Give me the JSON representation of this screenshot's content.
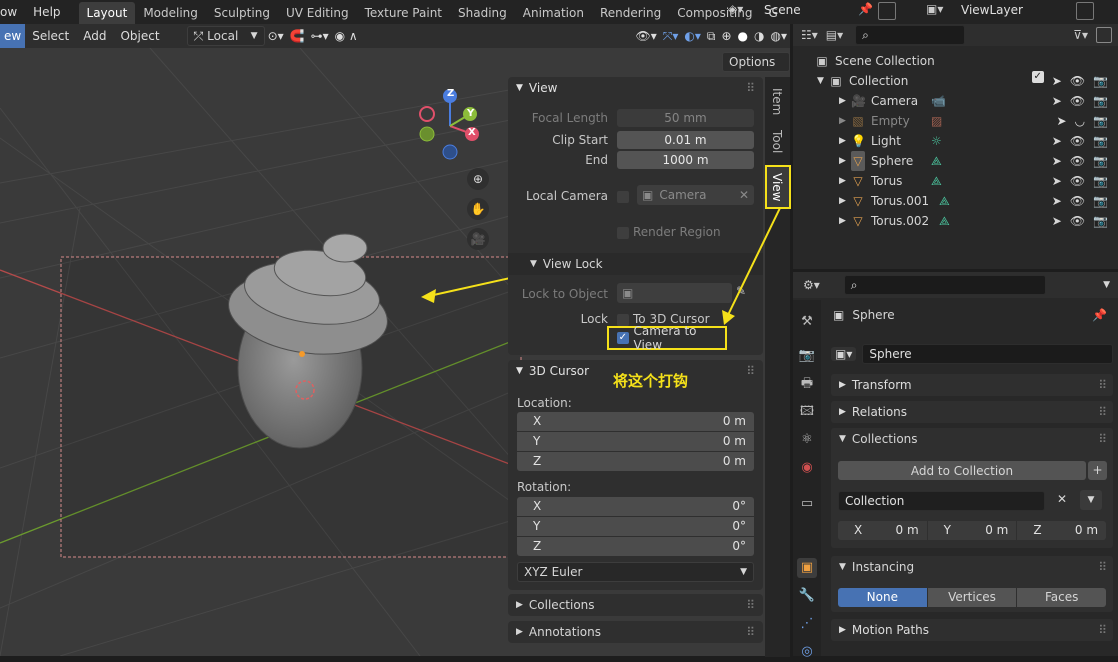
{
  "topbar": {
    "menus": [
      "ow",
      "Help"
    ],
    "workspaces": [
      "Layout",
      "Modeling",
      "Sculpting",
      "UV Editing",
      "Texture Paint",
      "Shading",
      "Animation",
      "Rendering",
      "Compositing",
      "G"
    ],
    "active_workspace": "Layout",
    "scene": "Scene",
    "view_layer": "ViewLayer"
  },
  "viewport_header": {
    "mode": "ew",
    "menus": [
      "Select",
      "Add",
      "Object"
    ],
    "transform_orientation": "Local",
    "options_label": "Options"
  },
  "npanel": {
    "tabs": [
      "Item",
      "Tool",
      "View"
    ],
    "active_tab": "View",
    "view_section": {
      "title": "View",
      "focal_length_label": "Focal Length",
      "focal_length_value": "50 mm",
      "clip_start_label": "Clip Start",
      "clip_start_value": "0.01 m",
      "end_label": "End",
      "end_value": "1000 m",
      "local_camera_label": "Local Camera",
      "local_camera_value": "Camera",
      "render_region_label": "Render Region"
    },
    "view_lock": {
      "title": "View Lock",
      "lock_to_object_label": "Lock to Object",
      "lock_label": "Lock",
      "to_3d_cursor_label": "To 3D Cursor",
      "camera_to_view_label": "Camera to View",
      "camera_to_view_checked": true
    },
    "cursor_section": {
      "title": "3D Cursor",
      "location_label": "Location:",
      "location": [
        {
          "axis": "X",
          "value": "0 m"
        },
        {
          "axis": "Y",
          "value": "0 m"
        },
        {
          "axis": "Z",
          "value": "0 m"
        }
      ],
      "rotation_label": "Rotation:",
      "rotation": [
        {
          "axis": "X",
          "value": "0°"
        },
        {
          "axis": "Y",
          "value": "0°"
        },
        {
          "axis": "Z",
          "value": "0°"
        }
      ],
      "rotation_mode": "XYZ Euler"
    },
    "collections_title": "Collections",
    "annotations_title": "Annotations"
  },
  "annotation_text": "将这个打钩",
  "gizmo": {
    "x": "X",
    "y": "Y",
    "z": "Z"
  },
  "outliner": {
    "scene_collection": "Scene Collection",
    "collection": "Collection",
    "objects": [
      {
        "name": "Camera",
        "dim": false
      },
      {
        "name": "Empty",
        "dim": true
      },
      {
        "name": "Light",
        "dim": false
      },
      {
        "name": "Sphere",
        "dim": false
      },
      {
        "name": "Torus",
        "dim": false
      },
      {
        "name": "Torus.001",
        "dim": false
      },
      {
        "name": "Torus.002",
        "dim": false
      }
    ]
  },
  "properties": {
    "object_name": "Sphere",
    "object_field": "Sphere",
    "sections": [
      "Transform",
      "Relations",
      "Collections"
    ],
    "add_to_collection": "Add to Collection",
    "collection_field": "Collection",
    "offset": [
      {
        "axis": "X",
        "value": "0 m"
      },
      {
        "axis": "Y",
        "value": "0 m"
      },
      {
        "axis": "Z",
        "value": "0 m"
      }
    ],
    "instancing_title": "Instancing",
    "instancing_options": [
      "None",
      "Vertices",
      "Faces"
    ],
    "instancing_active": "None",
    "motion_paths": "Motion Paths"
  },
  "colors": {
    "accent": "#4772b3",
    "annotation": "#f5e11a",
    "camera_frame": "#c56a6a"
  }
}
